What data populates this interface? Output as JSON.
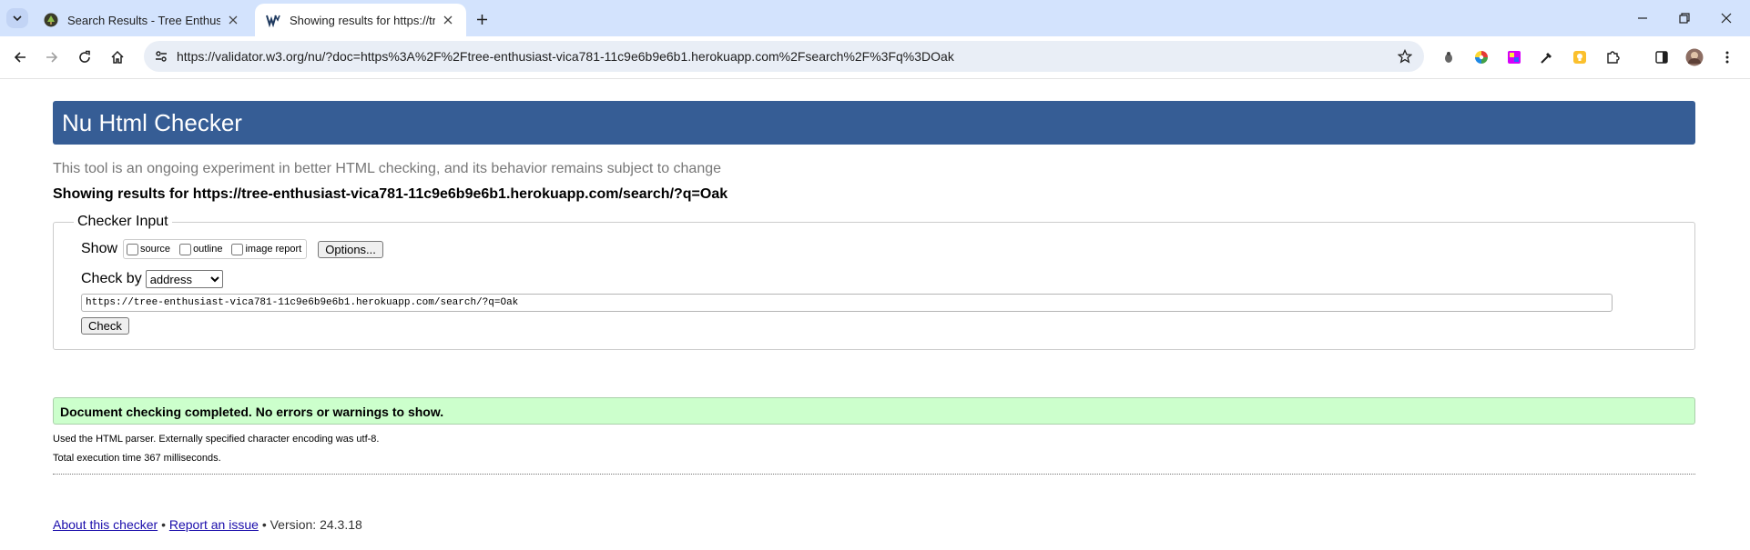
{
  "browser": {
    "tabs": [
      {
        "title": "Search Results - Tree Enthusiast",
        "active": false,
        "favicon": "tree-logo-icon"
      },
      {
        "title": "Showing results for https://tree",
        "active": true,
        "favicon": "w3c-validator-icon"
      }
    ],
    "url": "https://validator.w3.org/nu/?doc=https%3A%2F%2Ftree-enthusiast-vica781-11c9e6b9e6b1.herokuapp.com%2Fsearch%2F%3Fq%3DOak",
    "accent_color": "#d3e3fd"
  },
  "page": {
    "title": "Nu Html Checker",
    "tagline": "This tool is an ongoing experiment in better HTML checking, and its behavior remains subject to change",
    "showing_results": "Showing results for https://tree-enthusiast-vica781-11c9e6b9e6b1.herokuapp.com/search/?q=Oak",
    "header_color": "#365d95",
    "checker_input": {
      "legend": "Checker Input",
      "show_label": "Show",
      "show_options": [
        "source",
        "outline",
        "image report"
      ],
      "options_button": "Options...",
      "check_by_label": "Check by",
      "check_by_selected": "address",
      "url_value": "https://tree-enthusiast-vica781-11c9e6b9e6b1.herokuapp.com/search/?q=Oak",
      "check_button": "Check"
    },
    "result": {
      "message": "Document checking completed. No errors or warnings to show.",
      "success_color": "#ccffcc",
      "parser_info": "Used the HTML parser. Externally specified character encoding was utf-8.",
      "execution_time": "Total execution time 367 milliseconds."
    },
    "footer": {
      "about_link": "About this checker",
      "separator": "•",
      "report_link": "Report an issue",
      "version": "Version: 24.3.18"
    }
  }
}
